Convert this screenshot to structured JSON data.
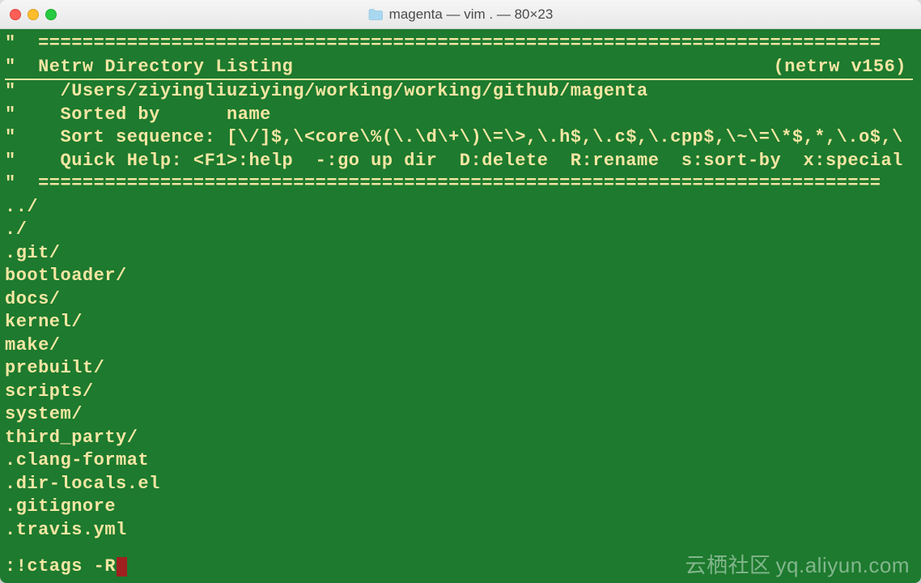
{
  "titlebar": {
    "title": "magenta — vim . — 80×23"
  },
  "netrw": {
    "separator": "\"  ============================================================================",
    "header_left": "\"  Netrw Directory Listing",
    "header_right": "(netrw v156)",
    "path": "\"    /Users/ziyingliuziying/working/working/github/magenta",
    "sorted_by": "\"    Sorted by      name",
    "sort_sequence": "\"    Sort sequence: [\\/]$,\\<core\\%(\\.\\d\\+\\)\\=\\>,\\.h$,\\.c$,\\.cpp$,\\~\\=\\*$,*,\\.o$,\\",
    "quick_help": "\"    Quick Help: <F1>:help  -:go up dir  D:delete  R:rename  s:sort-by  x:special",
    "entries": [
      "../",
      "./",
      ".git/",
      "bootloader/",
      "docs/",
      "kernel/",
      "make/",
      "prebuilt/",
      "scripts/",
      "system/",
      "third_party/",
      ".clang-format",
      ".dir-locals.el",
      ".gitignore",
      ".travis.yml"
    ]
  },
  "command": ":!ctags -R",
  "watermark": {
    "cn": "云栖社区",
    "url": "yq.aliyun.com"
  }
}
